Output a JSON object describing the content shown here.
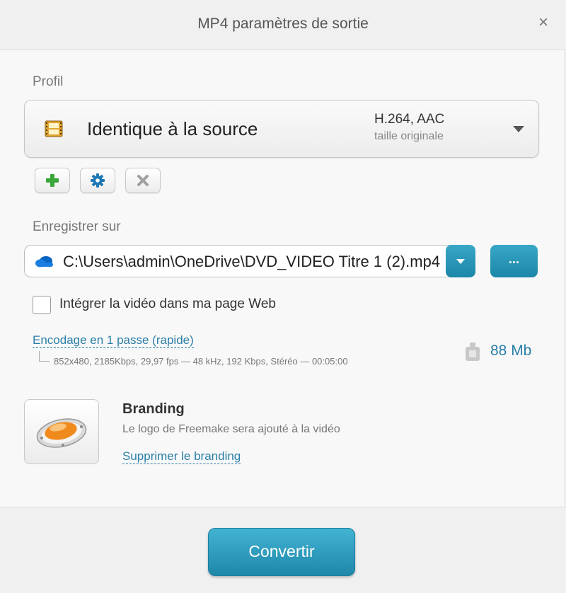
{
  "window": {
    "title": "MP4 paramètres de sortie",
    "close_icon": "×"
  },
  "profile": {
    "section_label": "Profil",
    "icon": "film-icon",
    "name": "Identique à la source",
    "codec": "H.264, AAC",
    "size_note": "taille originale"
  },
  "profile_actions": [
    {
      "name": "add",
      "icon": "plus-icon",
      "color": "#3aa63a"
    },
    {
      "name": "settings",
      "icon": "gear-icon",
      "color": "#1f78b4"
    },
    {
      "name": "delete",
      "icon": "x-icon",
      "color": "#9b9b9b"
    }
  ],
  "save": {
    "section_label": "Enregistrer sur",
    "path": "C:\\Users\\admin\\OneDrive\\DVD_VIDEO Titre 1 (2).mp4",
    "browse_label": "..."
  },
  "embed": {
    "label": "Intégrer la vidéo dans ma page Web",
    "checked": false
  },
  "encoding": {
    "mode_link": "Encodage en 1 passe (rapide)",
    "details": "852x480, 2185Kbps, 29,97 fps — 48 kHz, 192 Kbps, Stéréo — 00:05:00",
    "size": "88 Mb"
  },
  "branding": {
    "title": "Branding",
    "description": "Le logo de Freemake sera ajouté à la vidéo",
    "remove_link": "Supprimer le branding"
  },
  "footer": {
    "convert_label": "Convertir"
  },
  "colors": {
    "accent": "#1e87aa",
    "link": "#2a7fa8"
  }
}
